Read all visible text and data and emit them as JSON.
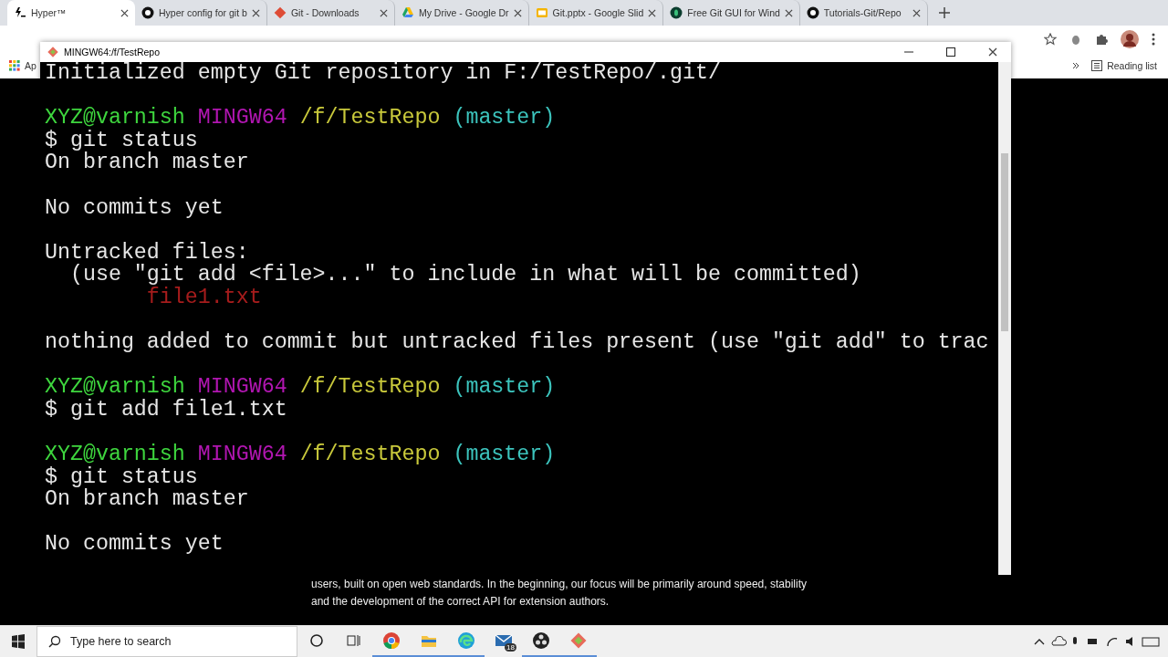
{
  "browser": {
    "tabs": [
      {
        "title": "Hyper™",
        "selected": true,
        "kind": "hyper"
      },
      {
        "title": "Hyper config for git b",
        "selected": false,
        "kind": "github"
      },
      {
        "title": "Git - Downloads",
        "selected": false,
        "kind": "git"
      },
      {
        "title": "My Drive - Google Dr",
        "selected": false,
        "kind": "drive"
      },
      {
        "title": "Git.pptx - Google Slid",
        "selected": false,
        "kind": "slides"
      },
      {
        "title": "Free Git GUI for Wind",
        "selected": false,
        "kind": "gitgui"
      },
      {
        "title": "Tutorials-Git/Repo",
        "selected": false,
        "kind": "github"
      }
    ],
    "bookmarks": [
      {
        "label": "Ap"
      }
    ],
    "reading_list": "Reading list",
    "page_text": [
      "users, built on open web standards. In the beginning, our focus will be primarily around speed, stability",
      "and the development of the correct API for extension authors."
    ]
  },
  "terminal": {
    "title": "MINGW64:/f/TestRepo",
    "lines": [
      {
        "kind": "text",
        "text": "Initialized empty Git repository in F:/TestRepo/.git/"
      },
      {
        "kind": "blank"
      },
      {
        "kind": "prompt",
        "user": "XYZ@varnish",
        "system": "MINGW64",
        "path": "/f/TestRepo",
        "branch": "(master)"
      },
      {
        "kind": "text",
        "text": "$ git status"
      },
      {
        "kind": "text",
        "text": "On branch master"
      },
      {
        "kind": "blank"
      },
      {
        "kind": "text",
        "text": "No commits yet"
      },
      {
        "kind": "blank"
      },
      {
        "kind": "text",
        "text": "Untracked files:"
      },
      {
        "kind": "text",
        "text": "  (use \"git add <file>...\" to include in what will be committed)"
      },
      {
        "kind": "untracked",
        "text": "        file1.txt"
      },
      {
        "kind": "blank"
      },
      {
        "kind": "text",
        "text": "nothing added to commit but untracked files present (use \"git add\" to trac"
      },
      {
        "kind": "blank"
      },
      {
        "kind": "prompt",
        "user": "XYZ@varnish",
        "system": "MINGW64",
        "path": "/f/TestRepo",
        "branch": "(master)"
      },
      {
        "kind": "text",
        "text": "$ git add file1.txt"
      },
      {
        "kind": "blank"
      },
      {
        "kind": "prompt",
        "user": "XYZ@varnish",
        "system": "MINGW64",
        "path": "/f/TestRepo",
        "branch": "(master)"
      },
      {
        "kind": "text",
        "text": "$ git status"
      },
      {
        "kind": "text",
        "text": "On branch master"
      },
      {
        "kind": "blank"
      },
      {
        "kind": "text",
        "text": "No commits yet"
      }
    ]
  },
  "taskbar": {
    "search": {
      "placeholder": "Type here to search"
    },
    "apps": [
      {
        "kind": "chrome",
        "running": true
      },
      {
        "kind": "explorer",
        "running": true
      },
      {
        "kind": "edge",
        "running": true
      },
      {
        "kind": "mail",
        "running": false,
        "badge": "18"
      },
      {
        "kind": "obs",
        "running": true
      },
      {
        "kind": "gitbash",
        "running": true
      }
    ]
  }
}
